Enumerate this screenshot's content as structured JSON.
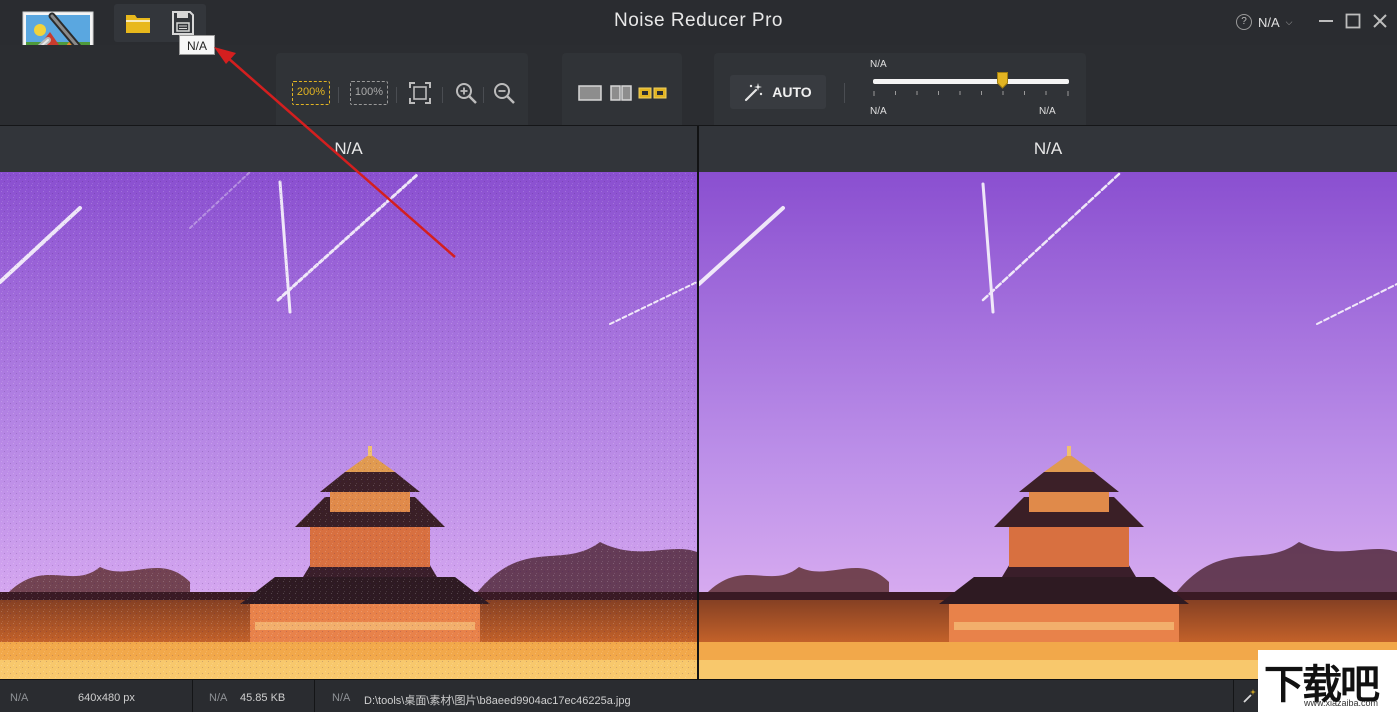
{
  "window": {
    "title": "Noise Reducer Pro",
    "language_label": "N/A",
    "help_glyph": "?"
  },
  "quick_tools": {
    "open_icon": "folder-icon",
    "save_icon": "save-icon",
    "save_tooltip": "N/A"
  },
  "toolbar": {
    "zoom_200_label": "200%",
    "zoom_100_label": "100%",
    "auto_label": "AUTO",
    "slider": {
      "title": "N/A",
      "min_label": "N/A",
      "max_label": "N/A",
      "value_fraction": 0.66
    }
  },
  "panes": {
    "left_title": "N/A",
    "right_title": "N/A"
  },
  "status": {
    "dim_label": "N/A",
    "dimensions": "640x480 px",
    "size_label": "N/A",
    "file_size": "45.85 KB",
    "path_label": "N/A",
    "file_path": "D:\\tools\\桌面\\素材\\图片\\b8aeed9904ac17ec46225a.jpg"
  },
  "watermark": {
    "main": "下载吧",
    "sub": "www.xiazaiba.com"
  },
  "colors": {
    "accent": "#e2b422",
    "annotation_arrow": "#d41f1f",
    "sky_top": "#8a4fd0",
    "sky_bottom": "#d6a8f0"
  }
}
